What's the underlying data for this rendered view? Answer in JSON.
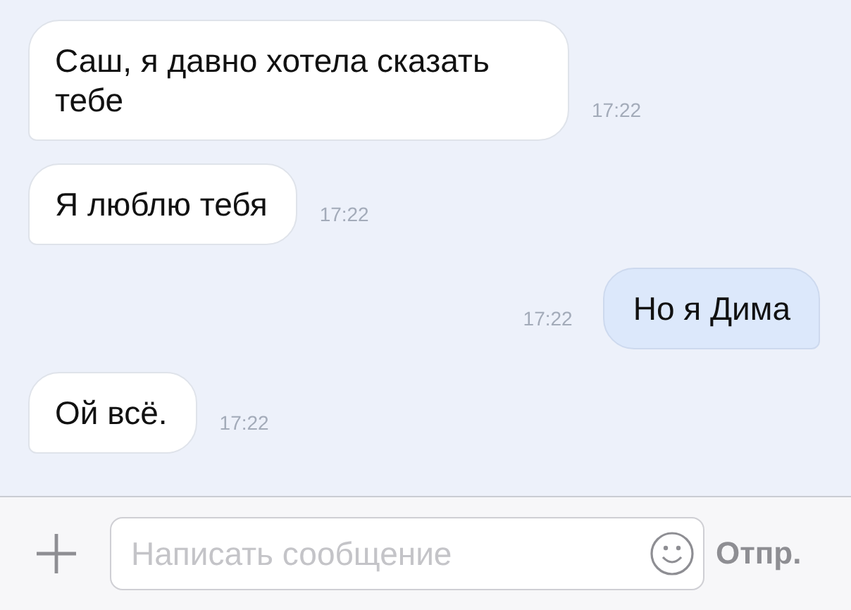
{
  "messages": [
    {
      "kind": "incoming",
      "text": "Саш, я давно хотела сказать тебе",
      "time": "17:22"
    },
    {
      "kind": "incoming",
      "text": "Я люблю тебя",
      "time": "17:22"
    },
    {
      "kind": "outgoing",
      "text": "Но я Дима",
      "time": "17:22"
    },
    {
      "kind": "incoming",
      "text": "Ой всё.",
      "time": "17:22"
    }
  ],
  "composer": {
    "placeholder": "Написать сообщение",
    "send": "Отпр."
  }
}
